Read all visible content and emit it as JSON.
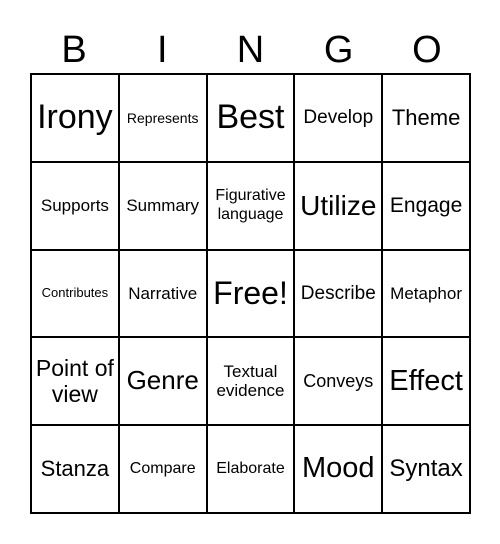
{
  "header": [
    "B",
    "I",
    "N",
    "G",
    "O"
  ],
  "cells": [
    "Irony",
    "Represents",
    "Best",
    "Develop",
    "Theme",
    "Supports",
    "Summary",
    "Figurative language",
    "Utilize",
    "Engage",
    "Contributes",
    "Narrative",
    "Free!",
    "Describe",
    "Metaphor",
    "Point of view",
    "Genre",
    "Textual evidence",
    "Conveys",
    "Effect",
    "Stanza",
    "Compare",
    "Elaborate",
    "Mood",
    "Syntax"
  ]
}
